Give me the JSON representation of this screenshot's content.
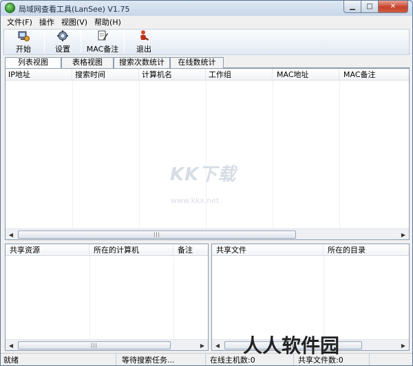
{
  "window": {
    "title": "局域网查看工具(LanSee) V1.75"
  },
  "menu": [
    "文件(F)",
    "操作",
    "视图(V)",
    "帮助(H)"
  ],
  "toolbar": {
    "start": "开始",
    "settings": "设置",
    "mac_note": "MAC备注",
    "exit": "退出"
  },
  "tabs": [
    "列表视图",
    "表格视图",
    "搜索次数统计",
    "在线数统计"
  ],
  "main_table": {
    "columns": [
      "IP地址",
      "搜索时间",
      "计算机名",
      "工作组",
      "MAC地址",
      "MAC备注"
    ]
  },
  "share_table": {
    "columns": [
      "共享资源",
      "所在的计算机",
      "备注"
    ]
  },
  "file_table": {
    "columns": [
      "共享文件",
      "所在的目录"
    ]
  },
  "status": {
    "ready": "就绪",
    "waiting": "等待搜索任务...",
    "online": "在线主机数:0",
    "share_count": "共享文件数:0"
  },
  "watermark": {
    "brand": "KK下载",
    "url": "www.kkx.net",
    "corner": "人人软件园"
  },
  "colors": {
    "titlebar": "#c7d6e8",
    "close_button": "#c7422b",
    "pane_border": "#8a9bb0"
  }
}
